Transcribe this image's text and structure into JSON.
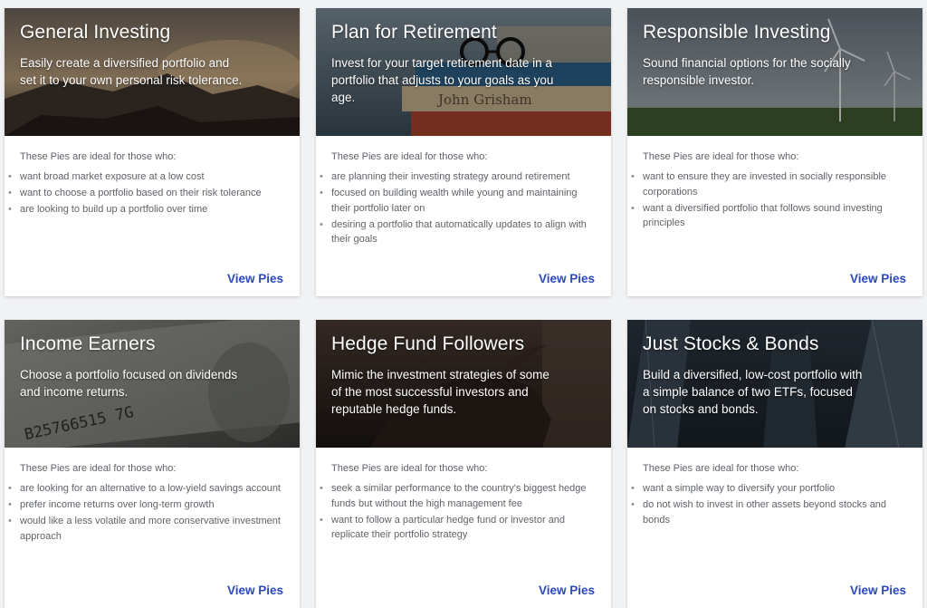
{
  "cards": [
    {
      "title": "General Investing",
      "description": "Easily create a diversified portfolio and set it to your own personal risk tolerance.",
      "ideal_label": "These Pies are ideal for those who:",
      "points": [
        "want broad market exposure at a low cost",
        "want to choose a portfolio based on their risk tolerance",
        "are looking to build up a portfolio over time"
      ],
      "cta": "View Pies"
    },
    {
      "title": "Plan for Retirement",
      "description": "Invest for your target retirement date in a portfolio that adjusts to your goals as you age.",
      "ideal_label": "These Pies are ideal for those who:",
      "points": [
        "are planning their investing strategy around retirement",
        "focused on building wealth while young and maintaining their portfolio later on",
        "desiring a portfolio that automatically updates to align with their goals"
      ],
      "cta": "View Pies",
      "image_text": "John Grisham"
    },
    {
      "title": "Responsible Investing",
      "description": "Sound financial options for the socially responsible investor.",
      "ideal_label": "These Pies are ideal for those who:",
      "points": [
        "want to ensure they are invested in socially responsible corporations",
        "want a diversified portfolio that follows sound investing principles"
      ],
      "cta": "View Pies"
    },
    {
      "title": "Income Earners",
      "description": "Choose a portfolio focused on dividends and income returns.",
      "ideal_label": "These Pies are ideal for those who:",
      "points": [
        "are looking for an alternative to a low-yield savings account",
        "prefer income returns over long-term growth",
        "would like a less volatile and more conservative investment approach"
      ],
      "cta": "View Pies",
      "image_text": "B25766515 7G"
    },
    {
      "title": "Hedge Fund Followers",
      "description": "Mimic the investment strategies of some of the most successful investors and reputable hedge funds.",
      "ideal_label": "These Pies are ideal for those who:",
      "points": [
        "seek a similar performance to the country's biggest hedge funds but without the high management fee",
        "want to follow a particular hedge fund or investor and replicate their portfolio strategy"
      ],
      "cta": "View Pies"
    },
    {
      "title": "Just Stocks & Bonds",
      "description": "Build a diversified, low-cost portfolio with a simple balance of two ETFs, focused on stocks and bonds.",
      "ideal_label": "These Pies are ideal for those who:",
      "points": [
        "want a simple way to diversify your portfolio",
        "do not wish to invest in other assets beyond stocks and bonds"
      ],
      "cta": "View Pies"
    }
  ],
  "colors": {
    "link": "#2b49b8",
    "body_text": "#5f6368",
    "page_bg": "#f1f2f4"
  }
}
